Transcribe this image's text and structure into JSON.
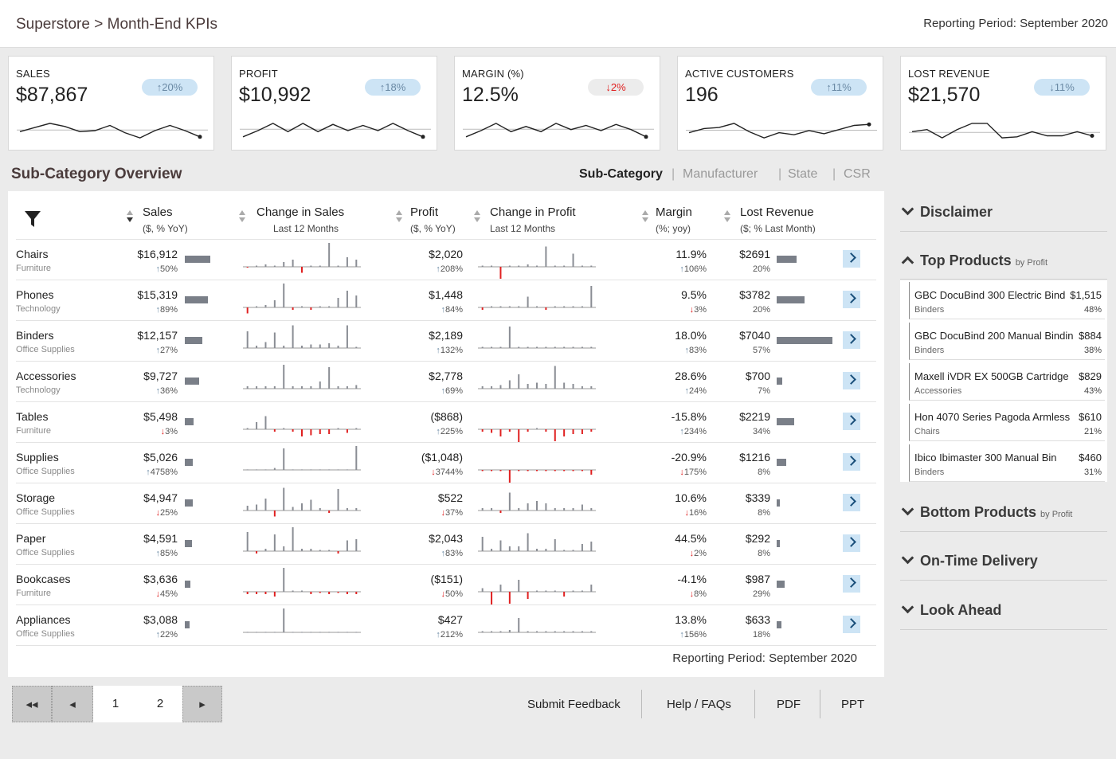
{
  "header": {
    "breadcrumb_root": "Superstore",
    "breadcrumb_sep": ">",
    "breadcrumb_page": "Month-End KPIs",
    "reporting_period": "Reporting Period: September 2020"
  },
  "kpis": [
    {
      "label": "SALES",
      "value": "$87,867",
      "change": "20%",
      "direction": "up",
      "spark": [
        0.55,
        0.35,
        0.15,
        0.3,
        0.55,
        0.5,
        0.25,
        0.6,
        0.85,
        0.5,
        0.25,
        0.5,
        0.8
      ]
    },
    {
      "label": "PROFIT",
      "value": "$10,992",
      "change": "18%",
      "direction": "up",
      "spark": [
        0.8,
        0.5,
        0.15,
        0.55,
        0.15,
        0.55,
        0.2,
        0.5,
        0.25,
        0.5,
        0.15,
        0.5,
        0.8
      ]
    },
    {
      "label": "MARGIN (%)",
      "value": "12.5%",
      "change": "2%",
      "direction": "down",
      "spark": [
        0.8,
        0.5,
        0.15,
        0.55,
        0.3,
        0.55,
        0.15,
        0.45,
        0.25,
        0.5,
        0.2,
        0.45,
        0.8
      ]
    },
    {
      "label": "ACTIVE CUSTOMERS",
      "value": "196",
      "change": "11%",
      "direction": "up",
      "spark": [
        0.6,
        0.4,
        0.35,
        0.15,
        0.55,
        0.85,
        0.6,
        0.7,
        0.5,
        0.65,
        0.45,
        0.25,
        0.2
      ]
    },
    {
      "label": "LOST REVENUE",
      "value": "$21,570",
      "change": "11%",
      "direction": "up_arrow_down",
      "spark": [
        0.55,
        0.45,
        0.85,
        0.45,
        0.15,
        0.15,
        0.85,
        0.8,
        0.55,
        0.75,
        0.75,
        0.55,
        0.75
      ]
    }
  ],
  "overview": {
    "title": "Sub-Category Overview",
    "tabs": [
      "Sub-Category",
      "Manufacturer",
      "State",
      "CSR"
    ],
    "tab_sep": "|",
    "active_tab": "Sub-Category",
    "columns": [
      {
        "head": "Sales",
        "sub": "($, % YoY)"
      },
      {
        "head": "Change in Sales",
        "sub": "Last 12 Months"
      },
      {
        "head": "Profit",
        "sub": "($, % YoY)"
      },
      {
        "head": "Change in Profit",
        "sub": "Last 12 Months"
      },
      {
        "head": "Margin",
        "sub": "(%; yoy)"
      },
      {
        "head": "Lost Revenue",
        "sub": "($; % Last Month)"
      }
    ],
    "reporting_period": "Reporting Period: September 2020",
    "rows": [
      {
        "name": "Chairs",
        "cat": "Furniture",
        "sales": "$16,912",
        "sales_pct": "50%",
        "sales_dir": "up",
        "sales_frac": 0.46,
        "profit": "$2,020",
        "profit_pct": "208%",
        "profit_dir": "up",
        "margin": "11.9%",
        "margin_pct": "106%",
        "margin_dir": "up",
        "lost": "$2691",
        "lost_pct": "20%",
        "lost_frac": 0.35,
        "sales_spark": [
          -0.03,
          0.05,
          0.1,
          0.05,
          0.2,
          0.3,
          -0.25,
          0.05,
          0.05,
          1.0,
          0.05,
          0.4,
          0.3
        ],
        "profit_spark": [
          0.05,
          0.05,
          -0.5,
          0.05,
          0.05,
          0.1,
          0.05,
          0.85,
          0.05,
          0.05,
          0.55,
          0.05,
          0.05
        ]
      },
      {
        "name": "Phones",
        "cat": "Technology",
        "sales": "$15,319",
        "sales_pct": "89%",
        "sales_dir": "up",
        "sales_frac": 0.42,
        "profit": "$1,448",
        "profit_pct": "84%",
        "profit_dir": "up",
        "margin": "9.5%",
        "margin_pct": "3%",
        "margin_dir": "down",
        "lost": "$3782",
        "lost_pct": "20%",
        "lost_frac": 0.5,
        "sales_spark": [
          -0.25,
          0.05,
          0.1,
          0.3,
          1.0,
          -0.1,
          0.05,
          -0.1,
          0.05,
          0.05,
          0.4,
          0.7,
          0.5
        ],
        "profit_spark": [
          -0.1,
          0.05,
          0.05,
          0.05,
          0.05,
          0.45,
          0.05,
          -0.1,
          0.05,
          0.05,
          0.05,
          0.05,
          0.9
        ]
      },
      {
        "name": "Binders",
        "cat": "Office Supplies",
        "sales": "$12,157",
        "sales_pct": "27%",
        "sales_dir": "up",
        "sales_frac": 0.32,
        "profit": "$2,189",
        "profit_pct": "132%",
        "profit_dir": "up",
        "margin": "18.0%",
        "margin_pct": "83%",
        "margin_dir": "up",
        "lost": "$7040",
        "lost_pct": "57%",
        "lost_frac": 1.0,
        "sales_spark": [
          0.7,
          0.1,
          0.25,
          0.65,
          0.1,
          0.95,
          0.1,
          0.15,
          0.15,
          0.2,
          0.1,
          0.95,
          0.05
        ],
        "profit_spark": [
          0.05,
          0.05,
          0.05,
          0.9,
          0.05,
          0.05,
          0.05,
          0.05,
          0.05,
          0.05,
          0.05,
          0.05,
          0.05
        ]
      },
      {
        "name": "Accessories",
        "cat": "Technology",
        "sales": "$9,727",
        "sales_pct": "36%",
        "sales_dir": "up",
        "sales_frac": 0.26,
        "profit": "$2,778",
        "profit_pct": "69%",
        "profit_dir": "up",
        "margin": "28.6%",
        "margin_pct": "24%",
        "margin_dir": "up",
        "lost": "$700",
        "lost_pct": "7%",
        "lost_frac": 0.1,
        "sales_spark": [
          0.1,
          0.1,
          0.1,
          0.1,
          1.0,
          0.1,
          0.1,
          0.1,
          0.3,
          0.9,
          0.1,
          0.1,
          0.15
        ],
        "profit_spark": [
          0.1,
          0.1,
          0.15,
          0.35,
          0.6,
          0.2,
          0.25,
          0.2,
          0.95,
          0.25,
          0.2,
          0.1,
          0.1
        ]
      },
      {
        "name": "Tables",
        "cat": "Furniture",
        "sales": "$5,498",
        "sales_pct": "3%",
        "sales_dir": "down",
        "sales_frac": 0.15,
        "profit": "($868)",
        "profit_pct": "225%",
        "profit_dir": "up",
        "margin": "-15.8%",
        "margin_pct": "234%",
        "margin_dir": "up",
        "lost": "$2219",
        "lost_pct": "34%",
        "lost_frac": 0.31,
        "sales_spark": [
          0.05,
          0.3,
          0.55,
          -0.1,
          0.05,
          -0.1,
          -0.3,
          -0.25,
          -0.2,
          -0.2,
          0.05,
          -0.15,
          0.05
        ],
        "profit_spark": [
          -0.1,
          -0.15,
          -0.3,
          -0.1,
          -0.9,
          -0.1,
          0.05,
          -0.1,
          -0.5,
          -0.3,
          -0.2,
          -0.2,
          -0.1
        ]
      },
      {
        "name": "Supplies",
        "cat": "Office Supplies",
        "sales": "$5,026",
        "sales_pct": "4758%",
        "sales_dir": "up",
        "sales_frac": 0.14,
        "profit": "($1,048)",
        "profit_pct": "3744%",
        "profit_dir": "down",
        "margin": "-20.9%",
        "margin_pct": "175%",
        "margin_dir": "down",
        "lost": "$1216",
        "lost_pct": "8%",
        "lost_frac": 0.17,
        "sales_spark": [
          0.02,
          0.02,
          0.02,
          0.08,
          0.9,
          0.02,
          0.02,
          0.02,
          0.02,
          0.02,
          0.02,
          0.02,
          1.0
        ],
        "profit_spark": [
          -0.05,
          -0.05,
          -0.05,
          -0.95,
          -0.05,
          -0.05,
          -0.05,
          -0.05,
          -0.05,
          -0.05,
          -0.05,
          -0.05,
          -0.2
        ]
      },
      {
        "name": "Storage",
        "cat": "Office Supplies",
        "sales": "$4,947",
        "sales_pct": "25%",
        "sales_dir": "down",
        "sales_frac": 0.14,
        "profit": "$522",
        "profit_pct": "37%",
        "profit_dir": "down",
        "margin": "10.6%",
        "margin_pct": "16%",
        "margin_dir": "down",
        "lost": "$339",
        "lost_pct": "8%",
        "lost_frac": 0.05,
        "sales_spark": [
          0.2,
          0.25,
          0.5,
          -0.25,
          0.95,
          0.15,
          0.3,
          0.45,
          0.1,
          -0.1,
          0.9,
          0.1,
          0.1
        ],
        "profit_spark": [
          0.1,
          0.1,
          -0.1,
          0.75,
          0.1,
          0.3,
          0.4,
          0.3,
          0.1,
          0.1,
          0.1,
          0.25,
          0.1
        ]
      },
      {
        "name": "Paper",
        "cat": "Office Supplies",
        "sales": "$4,591",
        "sales_pct": "85%",
        "sales_dir": "up",
        "sales_frac": 0.13,
        "profit": "$2,043",
        "profit_pct": "83%",
        "profit_dir": "up",
        "margin": "44.5%",
        "margin_pct": "2%",
        "margin_dir": "down",
        "lost": "$292",
        "lost_pct": "8%",
        "lost_frac": 0.05,
        "sales_spark": [
          0.8,
          -0.1,
          0.1,
          0.7,
          0.2,
          1.0,
          0.1,
          0.1,
          0.05,
          0.05,
          -0.1,
          0.45,
          0.5
        ],
        "profit_spark": [
          0.6,
          0.1,
          0.45,
          0.2,
          0.2,
          0.75,
          0.1,
          0.1,
          0.5,
          0.05,
          0.05,
          0.3,
          0.4
        ]
      },
      {
        "name": "Bookcases",
        "cat": "Furniture",
        "sales": "$3,636",
        "sales_pct": "45%",
        "sales_dir": "down",
        "sales_frac": 0.1,
        "profit": "($151)",
        "profit_pct": "50%",
        "profit_dir": "down",
        "margin": "-4.1%",
        "margin_pct": "8%",
        "margin_dir": "down",
        "lost": "$987",
        "lost_pct": "29%",
        "lost_frac": 0.14,
        "sales_spark": [
          -0.1,
          -0.1,
          -0.1,
          -0.2,
          1.0,
          0.05,
          0.05,
          -0.1,
          -0.05,
          -0.1,
          -0.05,
          -0.1,
          -0.1
        ],
        "profit_spark": [
          0.15,
          -0.6,
          0.3,
          -0.5,
          0.5,
          -0.3,
          0.05,
          0.05,
          0.05,
          -0.2,
          0.05,
          0.05,
          0.3
        ]
      },
      {
        "name": "Appliances",
        "cat": "Office Supplies",
        "sales": "$3,088",
        "sales_pct": "22%",
        "sales_dir": "up",
        "sales_frac": 0.08,
        "profit": "$427",
        "profit_pct": "212%",
        "profit_dir": "up",
        "margin": "13.8%",
        "margin_pct": "156%",
        "margin_dir": "up",
        "lost": "$633",
        "lost_pct": "18%",
        "lost_frac": 0.09,
        "sales_spark": [
          0.02,
          0.02,
          0.02,
          0.02,
          1.0,
          0.02,
          0.02,
          0.02,
          0.02,
          0.02,
          0.02,
          0.02,
          0.02
        ],
        "profit_spark": [
          0.05,
          0.05,
          0.05,
          0.1,
          0.6,
          0.05,
          0.05,
          0.05,
          0.05,
          0.05,
          0.05,
          0.05,
          0.05
        ]
      }
    ]
  },
  "sidebar": {
    "disclaimer": "Disclaimer",
    "top_products": "Top Products",
    "by_profit": "by Profit",
    "bottom_products": "Bottom Products",
    "on_time": "On-Time Delivery",
    "look_ahead": "Look Ahead",
    "products": [
      {
        "name": "GBC DocuBind 300 Electric Bind",
        "value": "$1,515",
        "cat": "Binders",
        "pct": "48%"
      },
      {
        "name": "GBC DocuBind 200 Manual Bindin",
        "value": "$884",
        "cat": "Binders",
        "pct": "38%"
      },
      {
        "name": "Maxell iVDR EX 500GB Cartridge",
        "value": "$829",
        "cat": "Accessories",
        "pct": "43%"
      },
      {
        "name": "Hon 4070 Series Pagoda Armless",
        "value": "$610",
        "cat": "Chairs",
        "pct": "21%"
      },
      {
        "name": "Ibico Ibimaster 300 Manual Bin",
        "value": "$460",
        "cat": "Binders",
        "pct": "31%"
      }
    ]
  },
  "pager": {
    "first": "◂◂",
    "prev": "◂",
    "page1": "1",
    "page2": "2",
    "next": "▸"
  },
  "footer": {
    "feedback": "Submit Feedback",
    "help": "Help / FAQs",
    "pdf": "PDF",
    "ppt": "PPT"
  },
  "colors": {
    "up": "#6b8aa5",
    "down": "#e02020",
    "bar": "#8a8d94",
    "neg": "#e02020",
    "badge_up": "#cde4f5"
  }
}
